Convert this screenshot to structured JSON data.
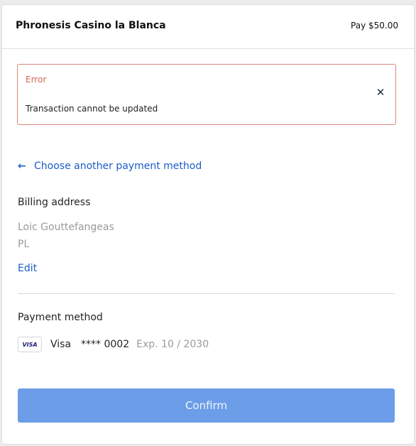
{
  "header": {
    "merchant": "Phronesis Casino la Blanca",
    "pay_label": "Pay $50.00"
  },
  "alert": {
    "title": "Error",
    "message": "Transaction cannot be updated",
    "close_icon": "close-icon"
  },
  "navigation": {
    "back_arrow": "←",
    "back_label": "Choose another payment method"
  },
  "billing": {
    "heading": "Billing address",
    "name": "Loic Gouttefangeas",
    "country": "PL",
    "edit_label": "Edit"
  },
  "payment": {
    "heading": "Payment method",
    "badge": "VISA",
    "brand": "Visa",
    "masked_number": "**** 0002",
    "expiry": "Exp. 10 / 2030"
  },
  "actions": {
    "confirm_label": "Confirm"
  },
  "colors": {
    "accent": "#1b5cc7",
    "error": "#d0654e",
    "confirm_button": "#6b9de8"
  }
}
